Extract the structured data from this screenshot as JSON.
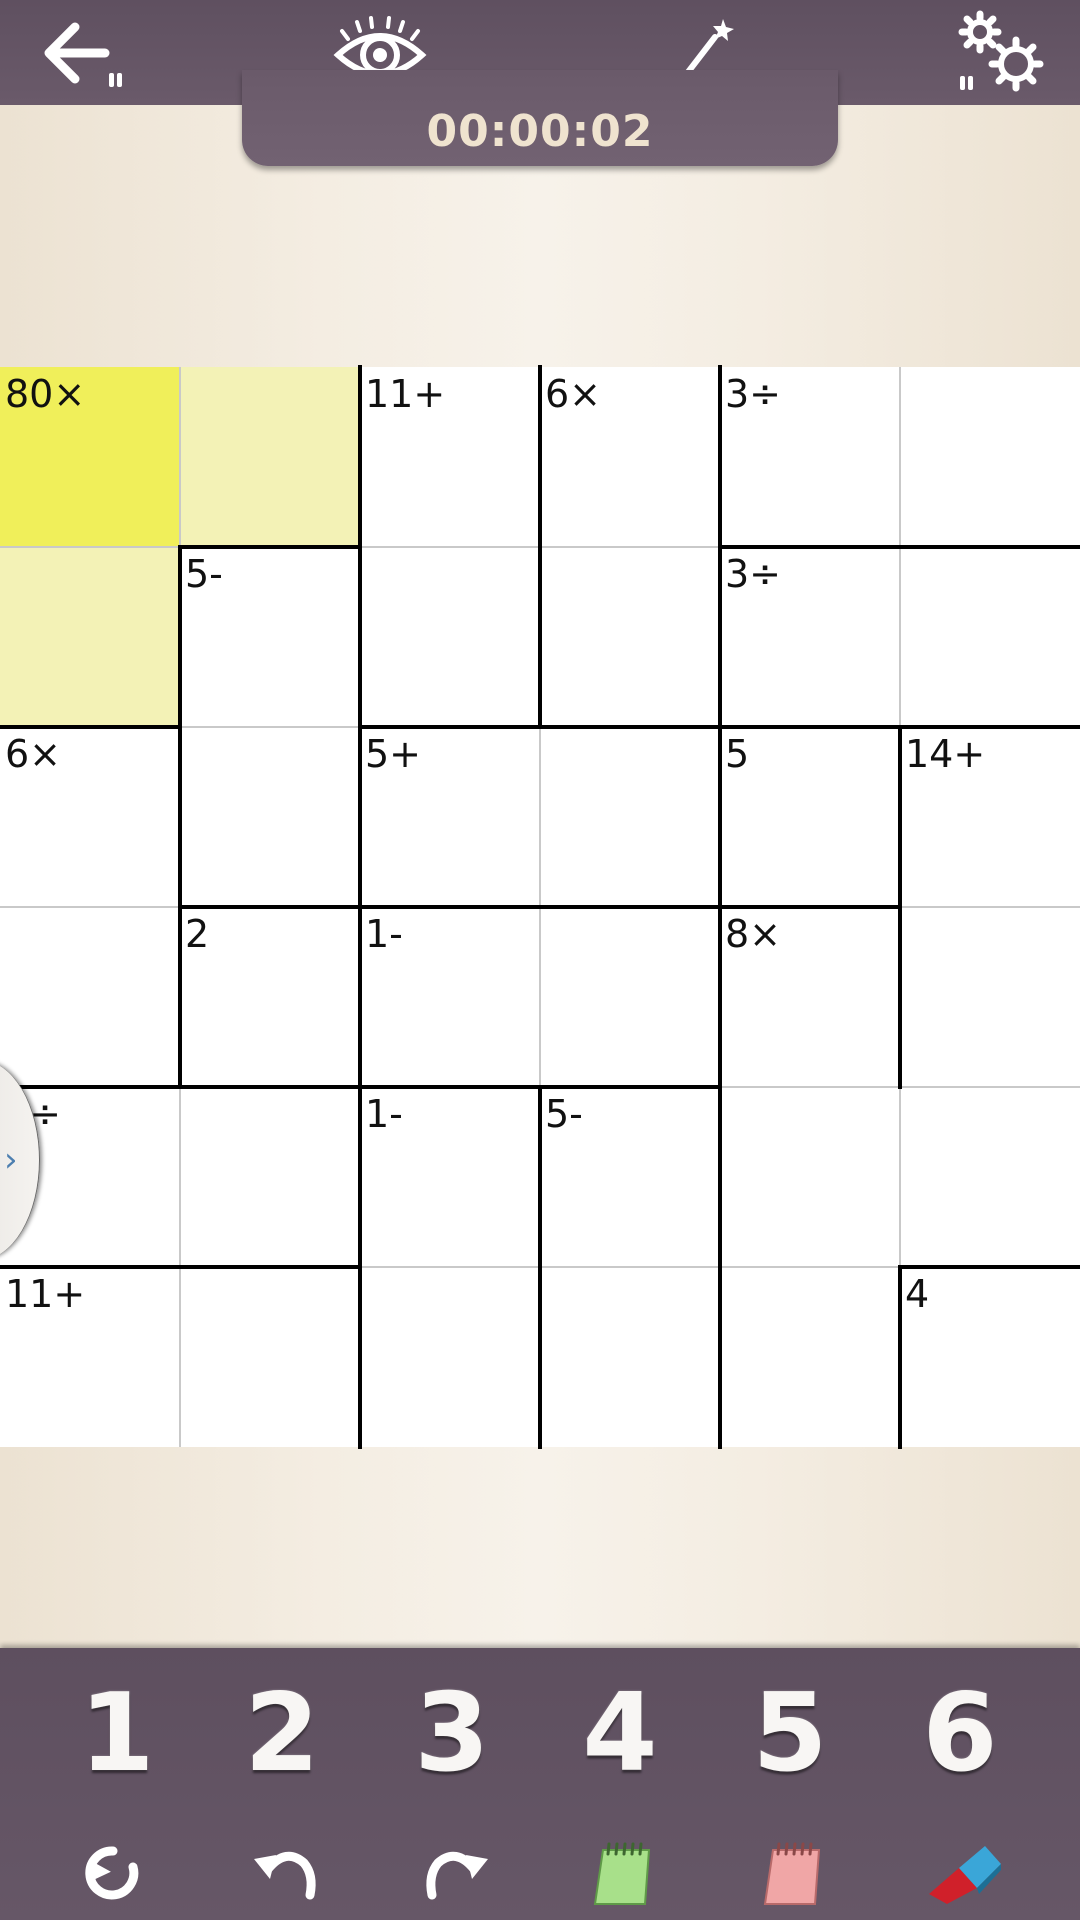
{
  "toolbar": {
    "back_icon": "back-arrow-icon",
    "reveal_icon": "eye-icon",
    "hint_icon": "magic-wand-icon",
    "settings_icon": "gears-icon"
  },
  "timer": "00:00:02",
  "board": {
    "size": 6,
    "clues": [
      [
        "80×",
        "",
        "11+",
        "6×",
        "3÷",
        ""
      ],
      [
        "",
        "5-",
        "",
        "",
        "3÷",
        ""
      ],
      [
        "6×",
        "",
        "5+",
        "",
        "5",
        "14+"
      ],
      [
        "",
        "2",
        "1-",
        "",
        "8×",
        ""
      ],
      [
        "3÷",
        "",
        "1-",
        "5-",
        "",
        ""
      ],
      [
        "11+",
        "",
        "",
        "",
        "",
        "4"
      ]
    ],
    "selected_cell": [
      0,
      0
    ],
    "highlighted_cells": [
      [
        0,
        1
      ],
      [
        1,
        0
      ]
    ],
    "colors": {
      "selected": "#f0ef5a",
      "highlighted": "#f3f2b6",
      "cell": "#ffffff"
    }
  },
  "number_pad": [
    "1",
    "2",
    "3",
    "4",
    "5",
    "6"
  ],
  "tools": [
    "reset-icon",
    "undo-icon",
    "redo-icon",
    "green-notepad-icon",
    "red-notepad-icon",
    "eraser-icon"
  ],
  "colors": {
    "bar": "#625262",
    "timer_text": "#efe3cf"
  }
}
